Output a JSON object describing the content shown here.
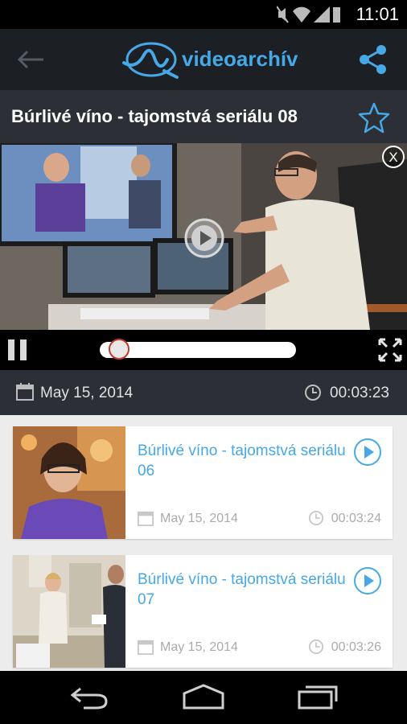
{
  "status_bar": {
    "time": "11:01"
  },
  "app_bar": {
    "logo_text": "videoarchív"
  },
  "video": {
    "title": "Búrlivé víno - tajomstvá seriálu 08",
    "close_label": "X",
    "progress": 0.05,
    "date": "May 15, 2014",
    "duration": "00:03:23"
  },
  "related": [
    {
      "title": "Búrlivé víno - tajomstvá seriálu 06",
      "date": "May 15, 2014",
      "duration": "00:03:24"
    },
    {
      "title": "Búrlivé víno - tajomstvá seriálu 07",
      "date": "May 15, 2014",
      "duration": "00:03:26"
    }
  ],
  "colors": {
    "accent": "#46a8e6",
    "appbar": "#1c1f23",
    "infobar": "#2c3036",
    "progress_thumb": "#c23c2e"
  },
  "icons": [
    "back-arrow-icon",
    "logo-wave-icon",
    "share-icon",
    "star-icon",
    "play-icon",
    "pause-icon",
    "fullscreen-icon",
    "calendar-icon",
    "clock-icon",
    "nav-back-icon",
    "nav-home-icon",
    "nav-recents-icon"
  ]
}
